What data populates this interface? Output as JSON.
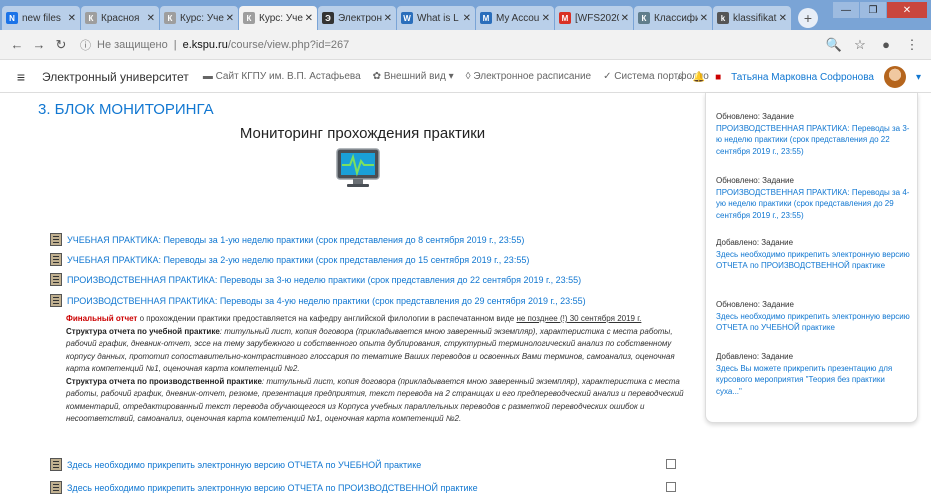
{
  "browser": {
    "tabs": [
      {
        "label": "new files",
        "color": "#1a73e8",
        "fav": "N"
      },
      {
        "label": "Красноя",
        "color": "#9e9e9e",
        "fav": "К"
      },
      {
        "label": "Курс: Учеб",
        "color": "#9e9e9e",
        "fav": "К"
      },
      {
        "label": "Курс: Учеб",
        "color": "#9e9e9e",
        "fav": "К",
        "active": true
      },
      {
        "label": "Электрон",
        "color": "#333333",
        "fav": "Э"
      },
      {
        "label": "What is L",
        "color": "#2a6ebb",
        "fav": "W"
      },
      {
        "label": "My Accou",
        "color": "#2a6ebb",
        "fav": "M"
      },
      {
        "label": "[WFS2020",
        "color": "#d93025",
        "fav": "M"
      },
      {
        "label": "Классифи",
        "color": "#607d8b",
        "fav": "К"
      },
      {
        "label": "klassifikat",
        "color": "#555555",
        "fav": "k"
      }
    ],
    "url_security": "Не защищено",
    "url_domain": "e.kspu.ru",
    "url_path": "/course/view.php?id=267"
  },
  "moodle": {
    "site_name": "Электронный университет",
    "nav": [
      "Сайт КГПУ им. В.П. Астафьева",
      "Внешний вид",
      "Электронное расписание",
      "Система портфолио"
    ],
    "user_name": "Татьяна Марковна Софронова"
  },
  "main": {
    "section_title": "3. БЛОК МОНИТОРИНГА",
    "monitor_title": "Мониторинг прохождения практики",
    "activities": [
      "УЧЕБНАЯ ПРАКТИКА: Переводы за 1-ую неделю практики (срок представления до 8 сентября 2019 г., 23:55)",
      "УЧЕБНАЯ ПРАКТИКА: Переводы за 2-ую неделю практики (срок представления до 15 сентября 2019 г., 23:55)",
      "ПРОИЗВОДСТВЕННАЯ ПРАКТИКА: Переводы за 3-ю неделю практики (срок представления до 22 сентября 2019 г., 23:55)",
      "ПРОИЗВОДСТВЕННАЯ ПРАКТИКА: Переводы за 4-ую неделю практики (срок представления до 29 сентября 2019 г., 23:55)"
    ],
    "final_red": "Финальный отчет",
    "final_text": " о прохождении практики предоставляется на кафедру английской филологии в распечатанном виде ",
    "final_deadline": "не позднее (!) 30 сентября 2019 г.",
    "study_head": "Структура отчета по учебной практике",
    "study_text": ": титульный лист, копия договора (прикладывается мною заверенный экземпляр), характеристика с места работы, рабочий график, дневник-отчет, эссе на тему зарубежного и собственного опыта дублирования, структурный терминологический анализ по собственному корпусу данных, прототип сопоставительно-контрастивного глоссария по тематике Ваших переводов и освоенных Вами терминов, самоанализ, оценочная карта компетенций №1, оценочная карта компетенций №2.",
    "prod_head": "Структура отчета по производственной практике",
    "prod_text": ": титульный лист, копия договора (прикладывается мною заверенный экземпляр), характеристика с места работы, рабочий график, дневник-отчет, резюме, презентация предприятия, текст перевода на 2 страницах и его предпереводческий анализ и переводческий комментарий, отредактированный текст перевода обучающегося из Корпуса учебных параллельных переводов с разметкой переводческих ошибок и несоответствий, самоанализ, оценочная карта компетенций №1, оценочная карта компетенций №2.",
    "uploads": [
      "Здесь необходимо прикрепить электронную версию ОТЧЕТА по УЧЕБНОЙ практике",
      "Здесь необходимо прикрепить электронную версию ОТЧЕТА по ПРОИЗВОДСТВЕННОЙ практике"
    ]
  },
  "recent": [
    {
      "label": "Обновлено: Задание",
      "link": "ПРОИЗВОДСТВЕННАЯ ПРАКТИКА: Переводы за 3-ю неделю практики (срок представления до 22 сентября 2019 г., 23:55)"
    },
    {
      "label": "Обновлено: Задание",
      "link": "ПРОИЗВОДСТВЕННАЯ ПРАКТИКА: Переводы за 4-ую неделю практики (срок представления до 29 сентября 2019 г., 23:55)"
    },
    {
      "label": "Добавлено: Задание",
      "link": "Здесь необходимо прикрепить электронную версию ОТЧЕТА по ПРОИЗВОДСТВЕННОЙ практике"
    },
    {
      "label": "Обновлено: Задание",
      "link": "Здесь необходимо прикрепить электронную версию ОТЧЕТА по УЧЕБНОЙ практике"
    },
    {
      "label": "Добавлено: Задание",
      "link": "Здесь Вы можете прикрепить презентацию для курсового мероприятия \"Теория без практики суха...\""
    }
  ]
}
